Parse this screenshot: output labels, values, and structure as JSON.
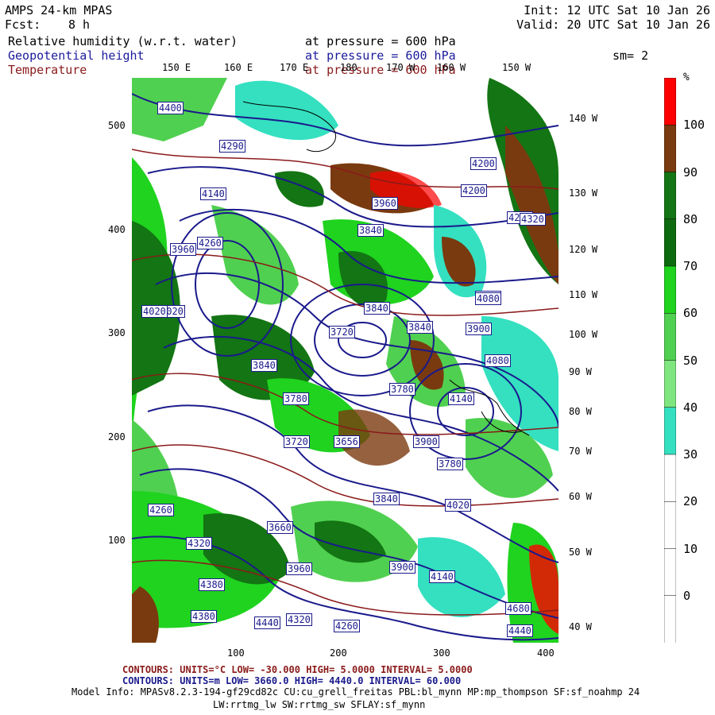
{
  "header": {
    "model": "AMPS 24-km MPAS",
    "fcst_label": "Fcst:",
    "fcst_value": "8 h",
    "init": "Init: 12 UTC Sat 10 Jan 26",
    "valid": "Valid: 20 UTC Sat 10 Jan 26",
    "fields": [
      {
        "name": "Relative humidity (w.r.t. water)",
        "level": "at pressure =  600 hPa"
      },
      {
        "name": "Geopotential height",
        "level": "at pressure =  600 hPa"
      },
      {
        "name": "Temperature",
        "level": "at pressure =  600 hPa"
      }
    ],
    "smoothing": "sm= 2"
  },
  "map": {
    "x_ticks": [
      "100",
      "200",
      "300",
      "400"
    ],
    "y_ticks": [
      "500",
      "400",
      "300",
      "200",
      "100"
    ],
    "lon_top": [
      "150 E",
      "160 E",
      "170 E",
      "180",
      "170 W",
      "160 W",
      "150 W"
    ],
    "lon_right": [
      "140 W",
      "130 W",
      "120 W",
      "110 W",
      "100 W",
      "90 W",
      "80 W",
      "70 W",
      "60 W",
      "50 W",
      "40 W"
    ],
    "height_labels": [
      "4400",
      "4380",
      "4320",
      "4290",
      "4140",
      "4260",
      "3960",
      "3720",
      "4440",
      "4080",
      "3960",
      "3900",
      "3840",
      "3780",
      "4020",
      "4140",
      "4200",
      "4260",
      "4320",
      "3840",
      "3780",
      "3720",
      "3656",
      "3900",
      "3840",
      "3660",
      "4020",
      "3840",
      "3780",
      "3840",
      "3900",
      "3960",
      "4080",
      "4140",
      "4200",
      "4320",
      "4260",
      "4260",
      "4380",
      "4440",
      "4680",
      "4020",
      "4080"
    ],
    "colors": {
      "rh_30_40": "#34e0c0",
      "rh_40_50": "#b2f0b2",
      "rh_50_60": "#50d050",
      "rh_60_70": "#1fd31f",
      "rh_70_80": "#137513",
      "rh_80_90": "#0e6a0e",
      "rh_90_100": "#7a3a0f",
      "rh_100": "#ff0000",
      "height_contour": "#1a1a8c",
      "temp_contour": "#8b1a1a"
    }
  },
  "colorbar": {
    "unit": "%",
    "labels": [
      "100",
      "90",
      "80",
      "70",
      "60",
      "50",
      "40",
      "30",
      "20",
      "10",
      "0"
    ],
    "colors": [
      "#ff0000",
      "#7a3a0f",
      "#137513",
      "#0e6a0e",
      "#1fd31f",
      "#50d050",
      "#7fe57f",
      "#34e0c0",
      "#ffffff",
      "#ffffff",
      "#ffffff",
      "#ffffff"
    ]
  },
  "footer": {
    "temp_contours": "CONTOURS:  UNITS=°C  LOW= -30.000        HIGH=  5.0000      INTERVAL=  5.0000",
    "height_contours": "CONTOURS:  UNITS=m  LOW=  3660.0       HIGH=  4440.0      INTERVAL=  60.000",
    "model_info": "Model Info: MPASv8.2.3-194-gf29cd82c CU:cu_grell_freitas PBL:bl_mynn MP:mp_thompson SF:sf_noahmp 24",
    "model_info2": "LW:rrtmg_lw SW:rrtmg_sw SFLAY:sf_mynn"
  }
}
